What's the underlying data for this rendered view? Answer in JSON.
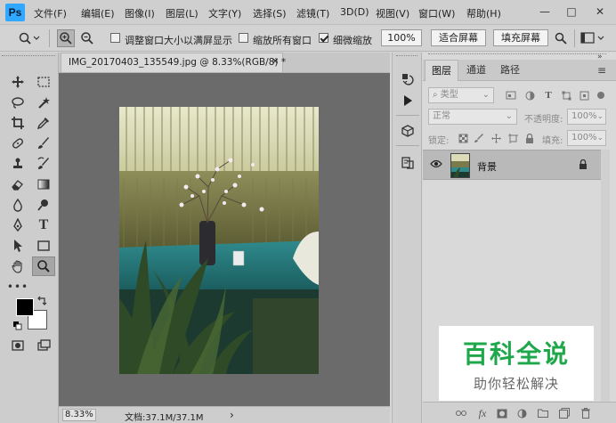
{
  "app": {
    "logo": "Ps",
    "menus": [
      "文件(F)",
      "编辑(E)",
      "图像(I)",
      "图层(L)",
      "文字(Y)",
      "选择(S)",
      "滤镜(T)",
      "3D(D)",
      "视图(V)",
      "窗口(W)",
      "帮助(H)"
    ],
    "window_controls": {
      "minimize": "—",
      "maximize": "□",
      "close": "✕"
    }
  },
  "options": {
    "resize_windows_label": "调整窗口大小以满屏显示",
    "zoom_all_label": "缩放所有窗口",
    "scrubby_zoom_label": "细微缩放",
    "zoom_percent": "100%",
    "fit_screen": "适合屏幕",
    "fill_screen": "填充屏幕"
  },
  "document": {
    "tab_title": "IMG_20170403_135549.jpg @ 8.33%(RGB/8) *",
    "tab_close": "✕",
    "status_zoom": "8.33%",
    "status_doc": "文档:37.1M/37.1M",
    "status_arrow": "›"
  },
  "layers": {
    "tabs": [
      "图层",
      "通道",
      "路径"
    ],
    "filter_kind": "类型",
    "blend_mode": "正常",
    "opacity_label": "不透明度:",
    "opacity_value": "100%",
    "lock_label": "锁定:",
    "fill_label": "填充:",
    "fill_value": "100%",
    "layer_name": "背景"
  },
  "watermark": {
    "title": "百科全说",
    "subtitle": "助你轻松解决"
  },
  "colors": {
    "ps_blue": "#31a8ff",
    "canvas_gray": "#6b6b6b",
    "watermark_green": "#1fa84b"
  }
}
